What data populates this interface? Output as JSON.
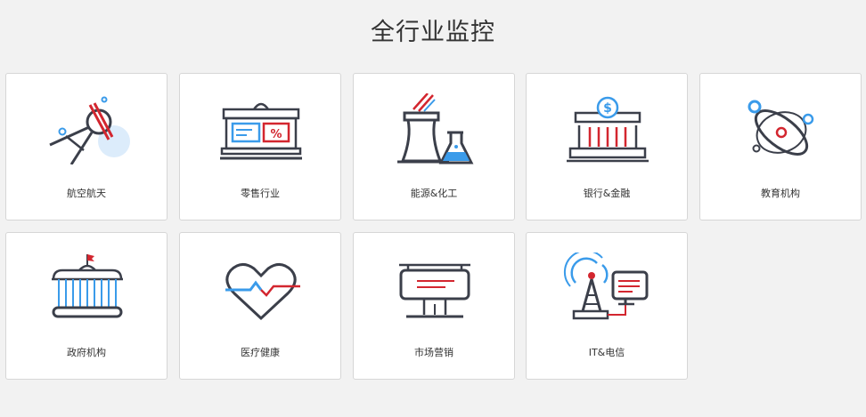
{
  "header": {
    "title": "全行业监控"
  },
  "industries": [
    {
      "label": "航空航天",
      "icon": "satellite-icon"
    },
    {
      "label": "零售行业",
      "icon": "store-icon"
    },
    {
      "label": "能源&化工",
      "icon": "factory-flask-icon"
    },
    {
      "label": "银行&金融",
      "icon": "bank-icon"
    },
    {
      "label": "教育机构",
      "icon": "atom-icon"
    },
    {
      "label": "政府机构",
      "icon": "government-building-icon"
    },
    {
      "label": "医疗健康",
      "icon": "heart-pulse-icon"
    },
    {
      "label": "市场营销",
      "icon": "billboard-icon"
    },
    {
      "label": "IT&电信",
      "icon": "antenna-monitor-icon"
    }
  ],
  "colors": {
    "background": "#f2f2f2",
    "card": "#ffffff",
    "dark": "#3b3f4a",
    "red": "#d3262f",
    "blue": "#3a9bea",
    "light_blue": "#dcecfb"
  }
}
